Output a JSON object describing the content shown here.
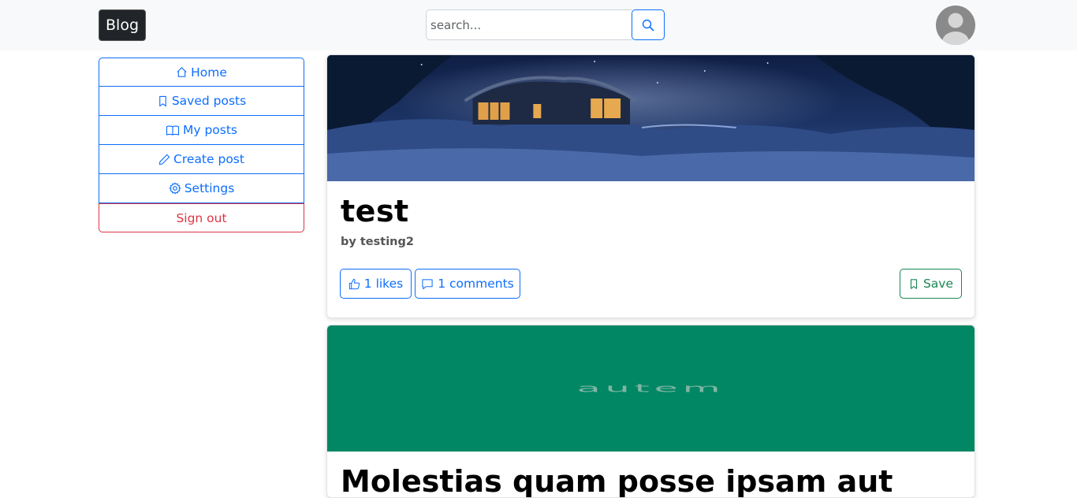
{
  "navbar": {
    "brand": "Blog",
    "search": {
      "placeholder": "search..."
    }
  },
  "sidebar": {
    "items": [
      {
        "label": "Home",
        "icon": "house-icon"
      },
      {
        "label": "Saved posts",
        "icon": "bookmark-icon"
      },
      {
        "label": "My posts",
        "icon": "book-icon"
      },
      {
        "label": "Create post",
        "icon": "pencil-icon"
      },
      {
        "label": "Settings",
        "icon": "gear-icon"
      },
      {
        "label": "Sign out"
      }
    ]
  },
  "posts": [
    {
      "title": "test",
      "author": "by testing2",
      "likes_label": "1 likes",
      "comments_label": "1 comments",
      "save_label": "Save"
    },
    {
      "image_text": "autem",
      "title": "Molestias quam posse ipsam aut",
      "image_color": "#018763"
    }
  ],
  "colors": {
    "primary": "#0d6efd",
    "danger": "#dc3545",
    "success": "#198754",
    "navbar_bg": "#f8f9fa"
  }
}
